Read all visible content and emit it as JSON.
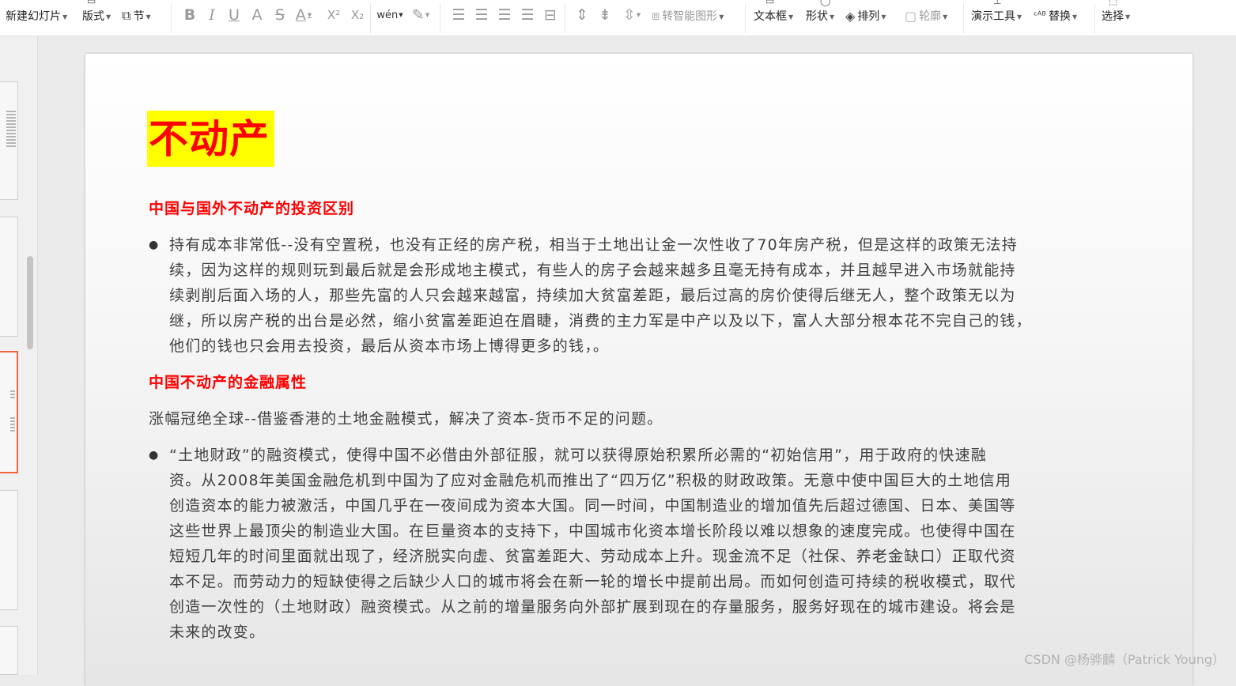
{
  "toolbar": {
    "new_slide": "新建幻灯片",
    "layout": "版式",
    "section": "节",
    "bold": "B",
    "italic": "I",
    "underline": "U",
    "shadow": "A",
    "strike": "S",
    "font_color": "A",
    "superscript": "X²",
    "subscript": "X₂",
    "phonetic": "wén",
    "smart_art": "转智能图形",
    "text_box": "文本框",
    "shape": "形状",
    "arrange": "排列",
    "outline": "轮廓",
    "presentation_tools": "演示工具",
    "replace": "替换",
    "select": "选择"
  },
  "slide": {
    "title": "不动产",
    "section1_heading": "中国与国外不动产的投资区别",
    "section1_bullet_lines": [
      "持有成本非常低--没有空置税，也没有正经的房产税，相当于土地出让金一次性收了70年房产税，但是这样的政策无法持",
      "续，因为这样的规则玩到最后就是会形成地主模式，有些人的房子会越来越多且毫无持有成本，并且越早进入市场就能持",
      "续剥削后面入场的人，那些先富的人只会越来越富，持续加大贫富差距，最后过高的房价使得后继无人，整个政策无以为",
      "继，所以房产税的出台是必然，缩小贫富差距迫在眉睫，消费的主力军是中产以及以下，富人大部分根本花不完自己的钱，",
      "他们的钱也只会用去投资，最后从资本市场上博得更多的钱，。"
    ],
    "section2_heading": "中国不动产的金融属性",
    "section2_para": "涨幅冠绝全球--借鉴香港的土地金融模式，解决了资本-货币不足的问题。",
    "section2_bullet_lines": [
      "“土地财政”的融资模式，使得中国不必借由外部征服，就可以获得原始积累所必需的“初始信用”，用于政府的快速融",
      "资。从2008年美国金融危机到中国为了应对金融危机而推出了“四万亿”积极的财政政策。无意中使中国巨大的土地信用",
      "创造资本的能力被激活，中国几乎在一夜间成为资本大国。同一时间，中国制造业的增加值先后超过德国、日本、美国等",
      "这些世界上最顶尖的制造业大国。在巨量资本的支持下，中国城市化资本增长阶段以难以想象的速度完成。也使得中国在",
      "短短几年的时间里面就出现了，经济脱实向虚、贫富差距大、劳动成本上升。现金流不足（社保、养老金缺口）正取代资",
      "本不足。而劳动力的短缺使得之后缺少人口的城市将会在新一轮的增长中提前出局。而如何创造可持续的税收模式，取代",
      "创造一次性的（土地财政）融资模式。从之前的增量服务向外部扩展到现在的存量服务，服务好现在的城市建设。将会是",
      "未来的改变。"
    ]
  },
  "watermark": "CSDN @杨骅麟（Patrick Young）",
  "colors": {
    "title_text": "#ff0000",
    "title_highlight": "#ffff00",
    "heading_text": "#ff0000",
    "active_thumb_border": "#f0643c"
  }
}
